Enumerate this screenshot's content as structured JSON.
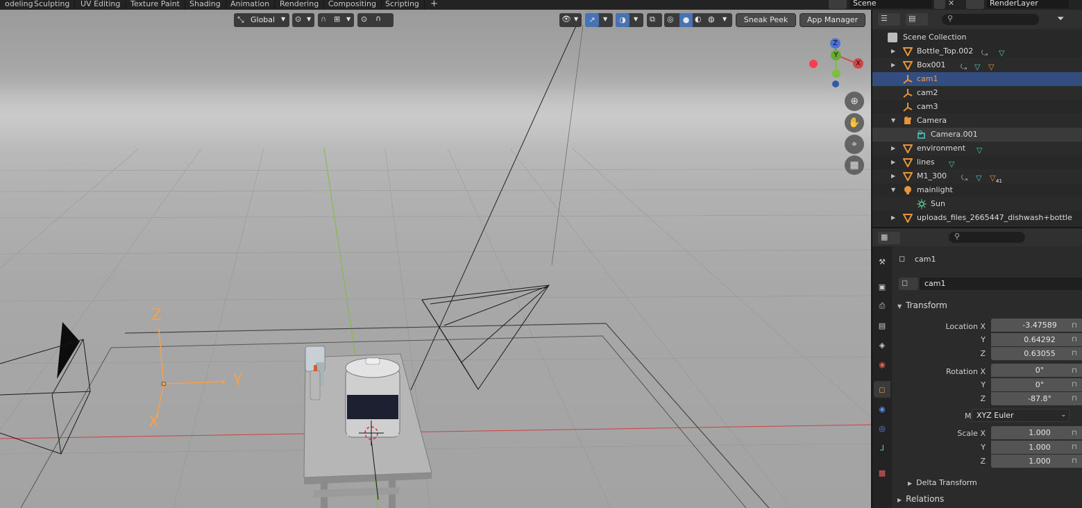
{
  "workspace_tabs": [
    "odeling",
    "Sculpting",
    "UV Editing",
    "Texture Paint",
    "Shading",
    "Animation",
    "Rendering",
    "Compositing",
    "Scripting",
    "+"
  ],
  "scene_field": "Scene",
  "view_layer_field": "RenderLayer",
  "viewport": {
    "transform_orientation": "Global",
    "sneak_peek_label": "Sneak Peek",
    "app_manager_label": "App Manager",
    "gizmo_axes": {
      "z": "Z",
      "y": "Y",
      "x": "X"
    },
    "object_axes": {
      "z": "Z",
      "y": "Y",
      "x": "X"
    },
    "colors": {
      "x_axis": "#cc3333",
      "y_axis": "#7bbf3a",
      "z_axis": "#3a6fcc",
      "selection": "#f7a14f"
    }
  },
  "outliner": {
    "root": "Scene Collection",
    "items": [
      {
        "label": "Bottle_Top.002",
        "expand": "▶",
        "icon": "mesh-object-icon"
      },
      {
        "label": "Box001",
        "expand": "▶",
        "icon": "mesh-object-icon"
      },
      {
        "label": "cam1",
        "expand": "",
        "icon": "empty-object-icon",
        "selected": true
      },
      {
        "label": "cam2",
        "expand": "",
        "icon": "empty-object-icon"
      },
      {
        "label": "cam3",
        "expand": "",
        "icon": "empty-object-icon"
      },
      {
        "label": "Camera",
        "expand": "▼",
        "icon": "camera-object-icon"
      },
      {
        "label": "Camera.001",
        "expand": "",
        "icon": "camera-data-icon",
        "child": true
      },
      {
        "label": "environment",
        "expand": "▶",
        "icon": "mesh-object-icon"
      },
      {
        "label": "lines",
        "expand": "▶",
        "icon": "mesh-object-icon"
      },
      {
        "label": "M1_300",
        "expand": "▶",
        "icon": "mesh-object-icon",
        "badge": "41"
      },
      {
        "label": "mainlight",
        "expand": "▼",
        "icon": "light-object-icon"
      },
      {
        "label": "Sun",
        "expand": "",
        "icon": "sun-data-icon",
        "child": true
      },
      {
        "label": "uploads_files_2665447_dishwash+bottle",
        "expand": "▶",
        "icon": "mesh-object-icon"
      }
    ]
  },
  "properties": {
    "object_name_header": "cam1",
    "object_name_field": "cam1",
    "transform_section": "Transform",
    "location_label": "Location X",
    "location": {
      "x": "-3.47589",
      "y": "0.64292",
      "z": "0.63055"
    },
    "rotation_label": "Rotation X",
    "rotation": {
      "x": "0°",
      "y": "0°",
      "z": "-87.8°"
    },
    "mode_label": "Mode",
    "mode_value": "XYZ Euler",
    "scale_label": "Scale X",
    "scale": {
      "x": "1.000",
      "y": "1.000",
      "z": "1.000"
    },
    "axis_y": "Y",
    "axis_z": "Z",
    "delta_section": "Delta Transform",
    "relations_section": "Relations"
  }
}
